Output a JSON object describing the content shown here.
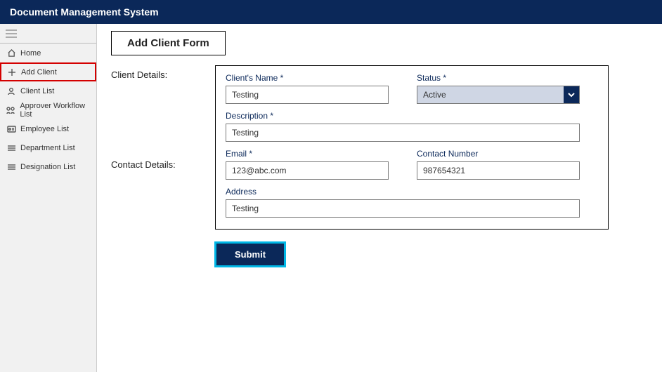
{
  "header": {
    "title": "Document Management System"
  },
  "sidebar": {
    "items": [
      {
        "label": "Home"
      },
      {
        "label": "Add Client"
      },
      {
        "label": "Client List"
      },
      {
        "label": "Approver Workflow List"
      },
      {
        "label": "Employee List"
      },
      {
        "label": "Department List"
      },
      {
        "label": "Designation List"
      }
    ]
  },
  "page": {
    "title": "Add Client Form",
    "sections": {
      "client": "Client Details:",
      "contact": "Contact Details:"
    },
    "fields": {
      "client_name": {
        "label": "Client's Name *",
        "value": "Testing"
      },
      "status": {
        "label": "Status *",
        "value": "Active"
      },
      "description": {
        "label": "Description *",
        "value": "Testing"
      },
      "email": {
        "label": "Email  *",
        "value": "123@abc.com"
      },
      "contact_number": {
        "label": "Contact Number",
        "value": "987654321"
      },
      "address": {
        "label": "Address",
        "value": "Testing"
      }
    },
    "submit": "Submit"
  }
}
